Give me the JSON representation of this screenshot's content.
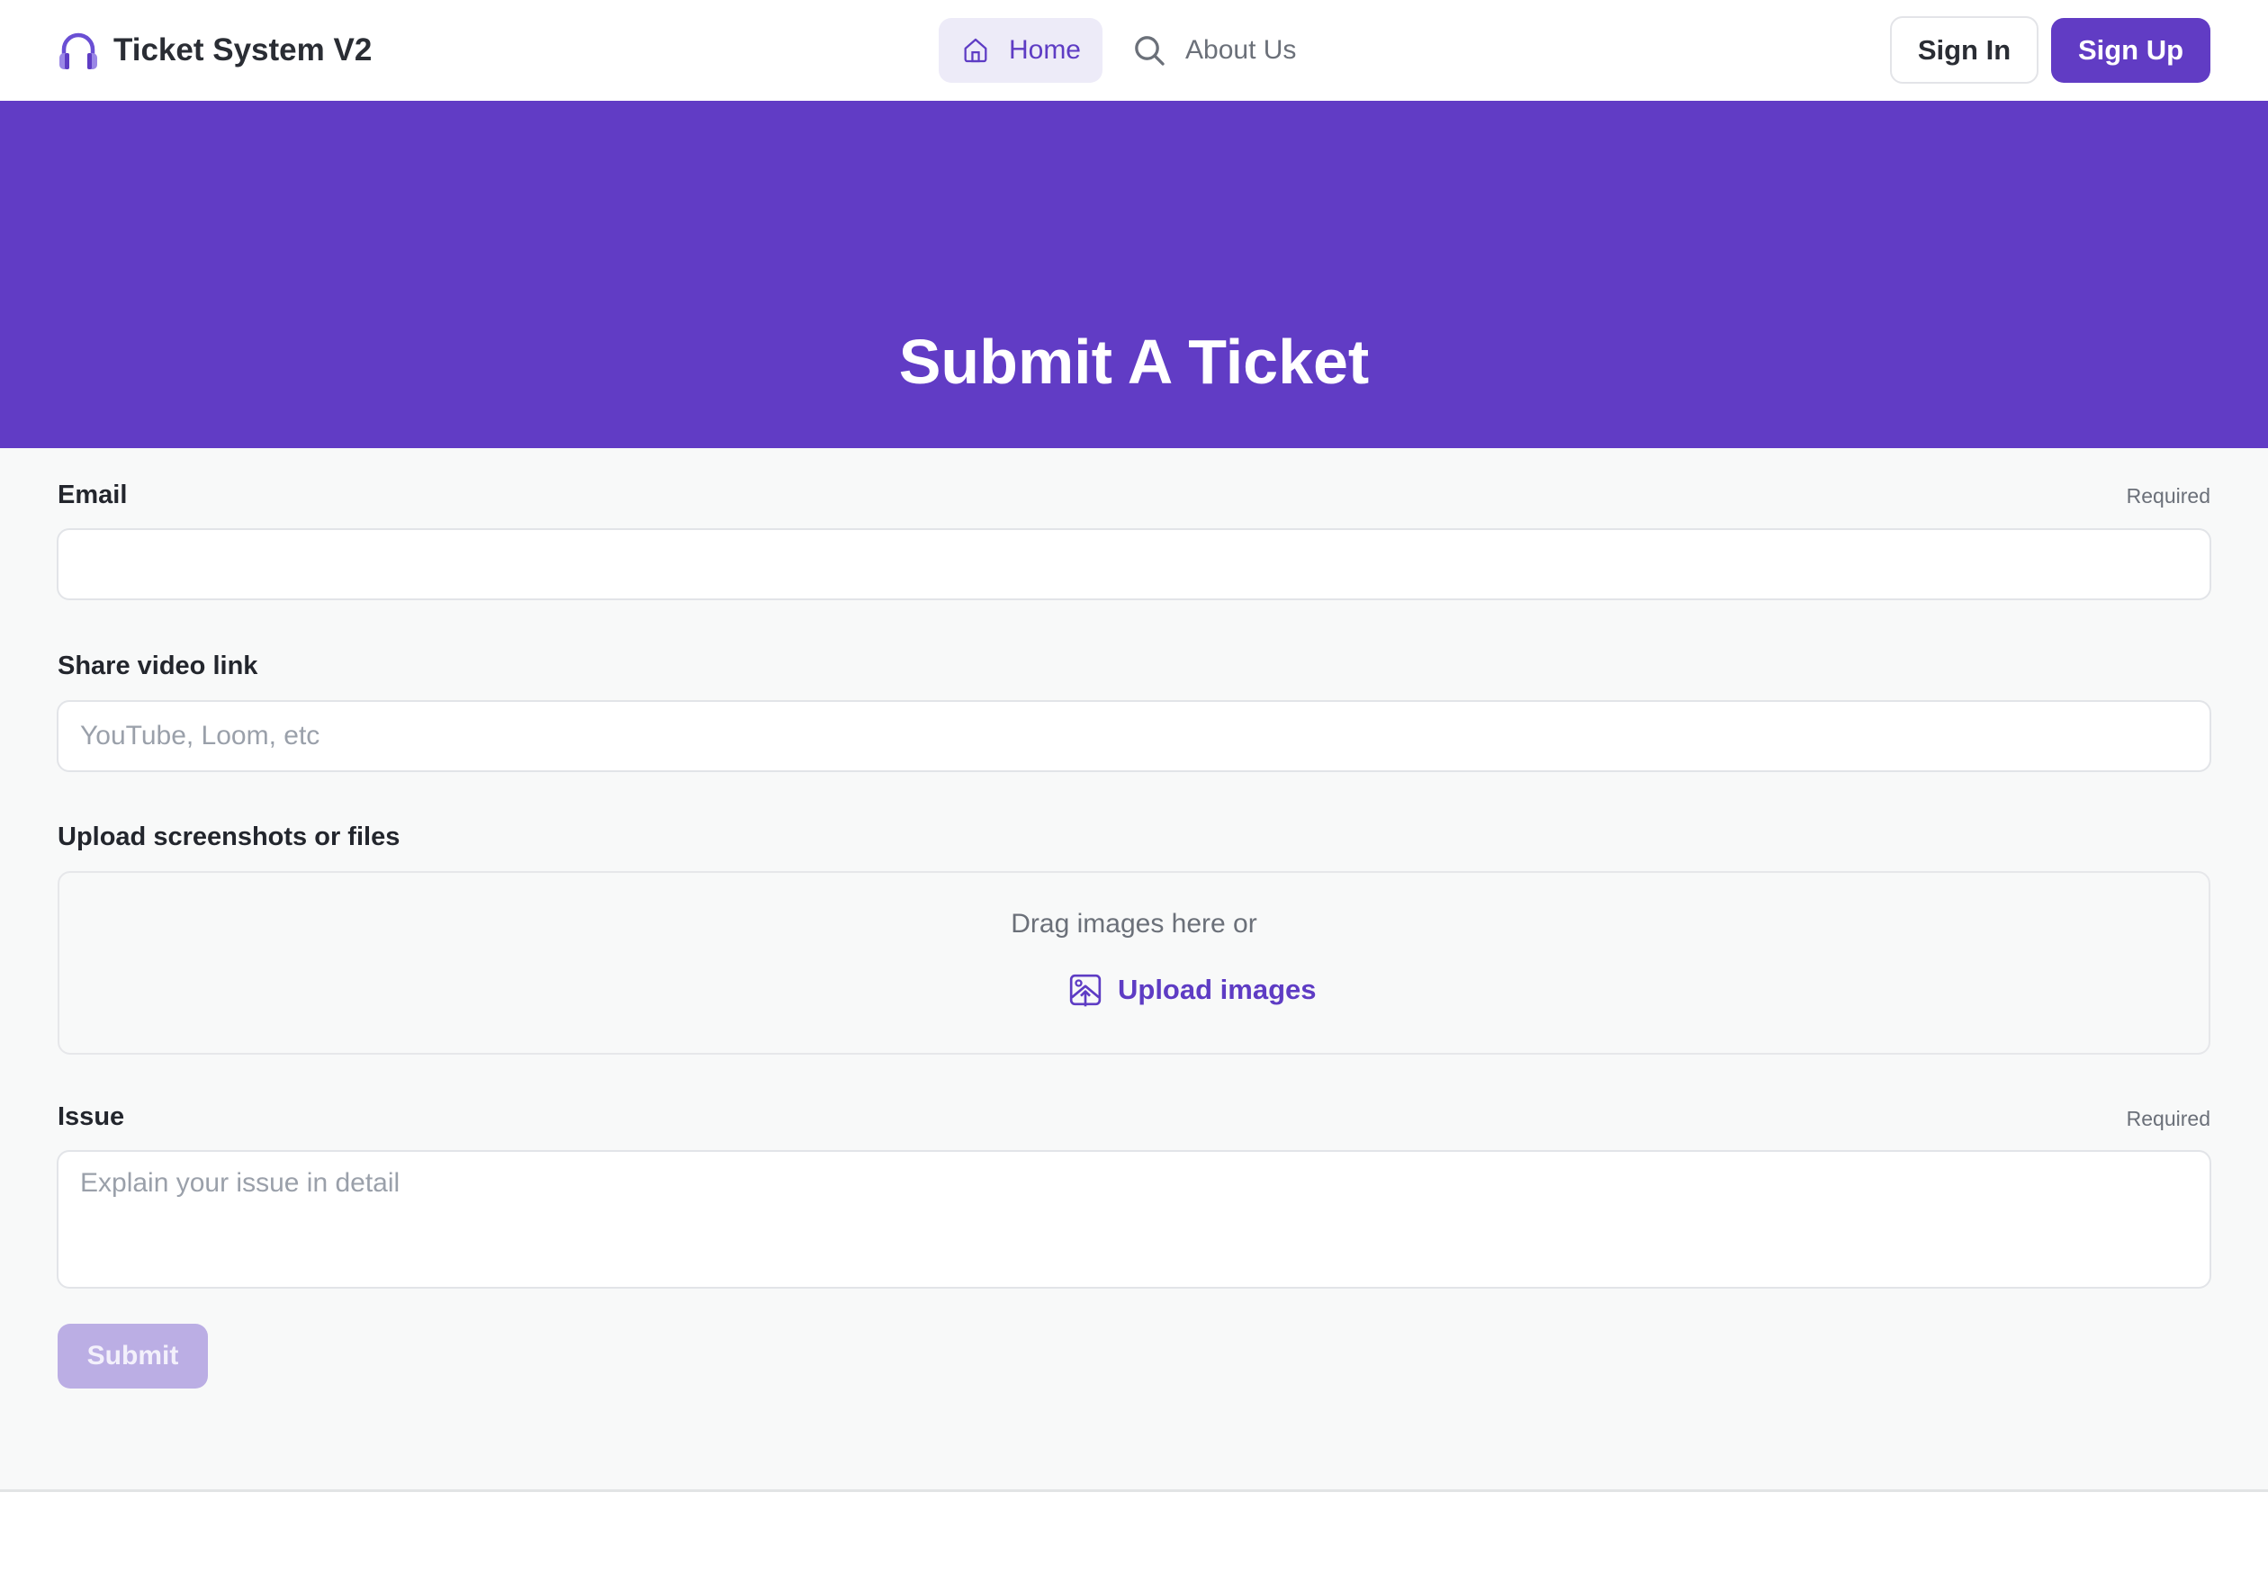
{
  "header": {
    "brand": {
      "title": "Ticket System V2",
      "icon": "headphones-icon"
    },
    "nav": [
      {
        "label": "Home",
        "icon": "home-icon",
        "active": true
      },
      {
        "label": "About Us",
        "icon": "search-icon",
        "active": false
      }
    ],
    "auth": {
      "sign_in_label": "Sign In",
      "sign_up_label": "Sign Up"
    }
  },
  "hero": {
    "title": "Submit A Ticket"
  },
  "form": {
    "email": {
      "label": "Email",
      "required_label": "Required",
      "value": "",
      "placeholder": ""
    },
    "video": {
      "label": "Share video link",
      "value": "",
      "placeholder": "YouTube, Loom, etc"
    },
    "upload": {
      "label": "Upload screenshots or files",
      "drag_text": "Drag images here or",
      "upload_label": "Upload images",
      "icon": "image-upload-icon"
    },
    "issue": {
      "label": "Issue",
      "required_label": "Required",
      "value": "",
      "placeholder": "Explain your issue in detail"
    },
    "submit_label": "Submit"
  },
  "colors": {
    "brand": "#613cc5",
    "brand_light": "#edebf8",
    "submit_disabled": "#bbaee4"
  }
}
